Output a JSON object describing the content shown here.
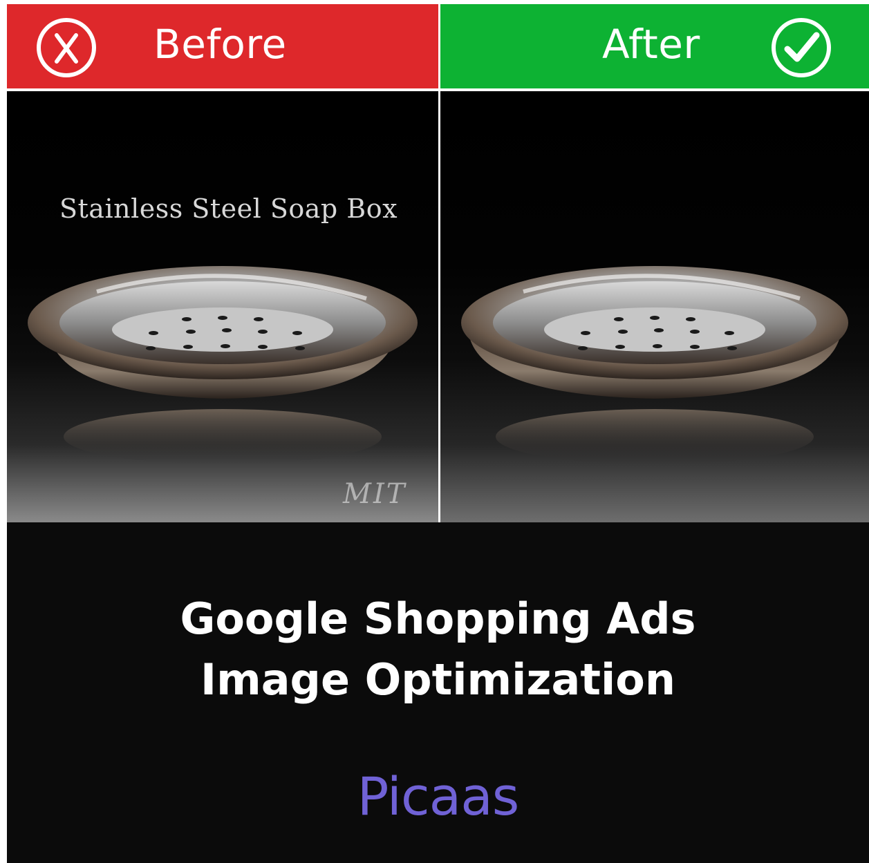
{
  "header": {
    "before_label": "Before",
    "after_label": "After",
    "before_icon": "x-circle-icon",
    "after_icon": "check-circle-icon",
    "before_color": "#de282b",
    "after_color": "#0db233"
  },
  "before_image": {
    "overlay_text": "Stainless Steel Soap Box",
    "watermark": "MIT"
  },
  "footer": {
    "headline_line1": "Google Shopping Ads",
    "headline_line2": "Image Optimization",
    "brand": "Picaas",
    "brand_color": "#7062d6"
  }
}
